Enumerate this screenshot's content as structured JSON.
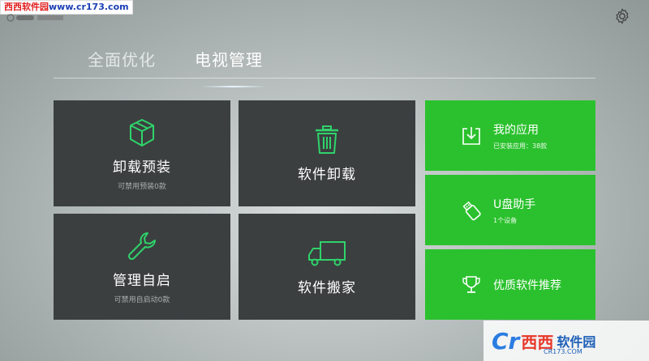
{
  "watermark": {
    "site_name": "西西软件园",
    "url": "www.cr173.com"
  },
  "tabs": [
    {
      "label": "全面优化",
      "active": false
    },
    {
      "label": "电视管理",
      "active": true
    }
  ],
  "tiles": {
    "uninstall_preinstalled": {
      "title": "卸载预装",
      "subtitle": "可禁用预装0款",
      "icon": "box-icon"
    },
    "software_uninstall": {
      "title": "软件卸载",
      "icon": "trash-icon"
    },
    "manage_autostart": {
      "title": "管理自启",
      "subtitle": "可禁用自启动0款",
      "icon": "wrench-icon"
    },
    "software_move": {
      "title": "软件搬家",
      "icon": "truck-icon"
    },
    "my_apps": {
      "title": "我的应用",
      "subtitle": "已安装应用：38款",
      "icon": "download-icon"
    },
    "usb_helper": {
      "title": "U盘助手",
      "subtitle": "1个设备",
      "icon": "usb-icon"
    },
    "recommended": {
      "title": "优质软件推荐",
      "icon": "trophy-icon"
    }
  },
  "watermark_bottom": {
    "cr": "Cr",
    "xixi": "西西",
    "soft": "软件园",
    "url": "CR173.COM"
  },
  "colors": {
    "accent_green": "#2bc12e",
    "icon_green": "#2fd36a",
    "tile_dark": "#3b3f40"
  }
}
